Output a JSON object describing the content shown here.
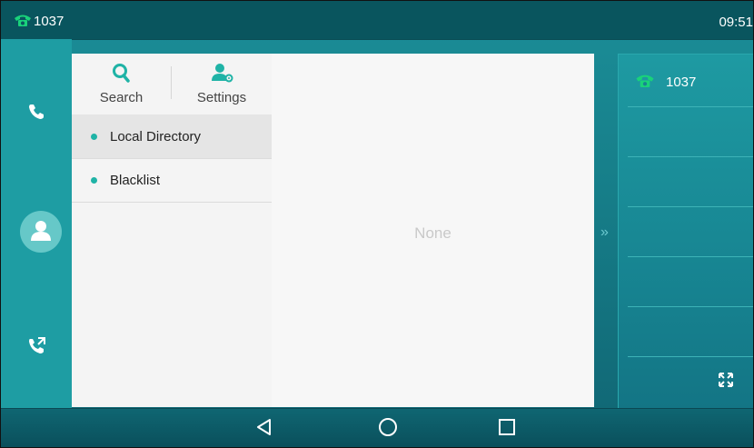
{
  "status_bar": {
    "extension": "1037",
    "time": "09:51"
  },
  "menu": {
    "search_label": "Search",
    "settings_label": "Settings",
    "items": [
      {
        "label": "Local Directory",
        "active": true
      },
      {
        "label": "Blacklist",
        "active": false
      }
    ]
  },
  "content": {
    "empty_text": "None"
  },
  "line_keys": {
    "line1_label": "1037"
  },
  "icons": {
    "status": "phone-handset-icon",
    "rail": [
      "phone-icon",
      "contact-avatar-icon",
      "call-history-icon"
    ],
    "menu": [
      "search-icon",
      "settings-user-icon"
    ],
    "content": [
      "add-icon"
    ],
    "right": [
      "chevron-right-icon",
      "expand-icon"
    ],
    "nav": [
      "back-icon",
      "home-icon",
      "recent-apps-icon"
    ]
  },
  "colors": {
    "accent": "#1fb3a6",
    "fab": "#1ba6e0",
    "line_icon": "#19d27a"
  }
}
